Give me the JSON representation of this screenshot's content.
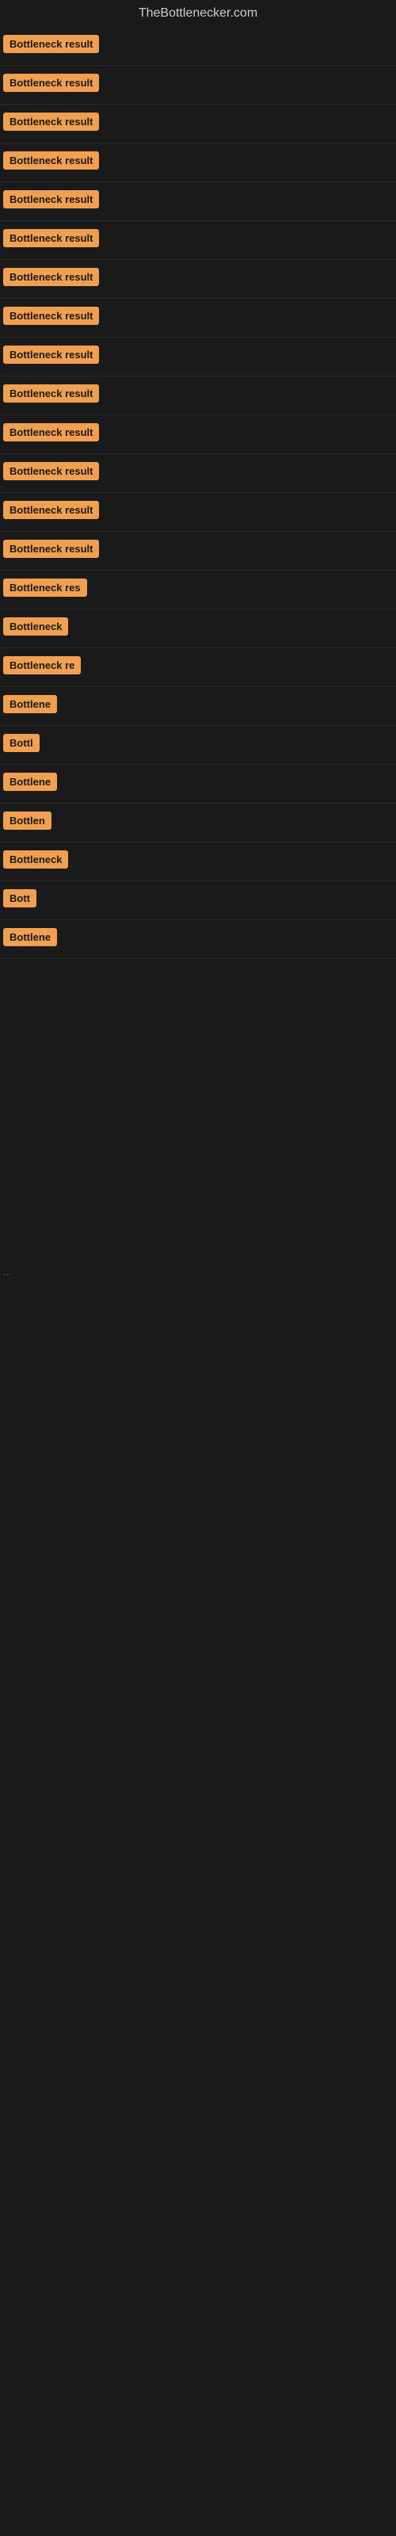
{
  "site": {
    "title": "TheBottlenecker.com"
  },
  "results": [
    {
      "id": 1,
      "label": "Bottleneck result",
      "width": 130
    },
    {
      "id": 2,
      "label": "Bottleneck result",
      "width": 130
    },
    {
      "id": 3,
      "label": "Bottleneck result",
      "width": 130
    },
    {
      "id": 4,
      "label": "Bottleneck result",
      "width": 130
    },
    {
      "id": 5,
      "label": "Bottleneck result",
      "width": 130
    },
    {
      "id": 6,
      "label": "Bottleneck result",
      "width": 130
    },
    {
      "id": 7,
      "label": "Bottleneck result",
      "width": 130
    },
    {
      "id": 8,
      "label": "Bottleneck result",
      "width": 130
    },
    {
      "id": 9,
      "label": "Bottleneck result",
      "width": 130
    },
    {
      "id": 10,
      "label": "Bottleneck result",
      "width": 130
    },
    {
      "id": 11,
      "label": "Bottleneck result",
      "width": 130
    },
    {
      "id": 12,
      "label": "Bottleneck result",
      "width": 130
    },
    {
      "id": 13,
      "label": "Bottleneck result",
      "width": 130
    },
    {
      "id": 14,
      "label": "Bottleneck result",
      "width": 130
    },
    {
      "id": 15,
      "label": "Bottleneck res",
      "width": 115
    },
    {
      "id": 16,
      "label": "Bottleneck",
      "width": 88
    },
    {
      "id": 17,
      "label": "Bottleneck re",
      "width": 100
    },
    {
      "id": 18,
      "label": "Bottlene",
      "width": 74
    },
    {
      "id": 19,
      "label": "Bottl",
      "width": 50
    },
    {
      "id": 20,
      "label": "Bottlene",
      "width": 74
    },
    {
      "id": 21,
      "label": "Bottlen",
      "width": 65
    },
    {
      "id": 22,
      "label": "Bottleneck",
      "width": 88
    },
    {
      "id": 23,
      "label": "Bott",
      "width": 42
    },
    {
      "id": 24,
      "label": "Bottlene",
      "width": 74
    }
  ],
  "ellipsis": "..."
}
